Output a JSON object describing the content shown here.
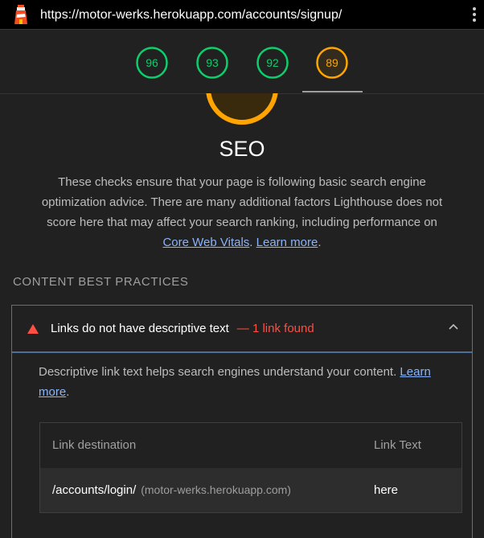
{
  "browser": {
    "url": "https://motor-werks.herokuapp.com/accounts/signup/"
  },
  "scores": [
    {
      "value": "96",
      "color": "#0cce6b"
    },
    {
      "value": "93",
      "color": "#0cce6b"
    },
    {
      "value": "92",
      "color": "#0cce6b"
    },
    {
      "value": "89",
      "color": "#ffa400"
    }
  ],
  "category": {
    "title": "SEO",
    "description_text": "These checks ensure that your page is following basic search engine optimization advice. There are many additional factors Lighthouse does not score here that may affect your search ranking, including performance on ",
    "core_web_vitals_link": "Core Web Vitals",
    "separator": ". ",
    "learn_more_link": "Learn more",
    "end_period": "."
  },
  "group": {
    "title": "CONTENT BEST PRACTICES"
  },
  "audit": {
    "title": "Links do not have descriptive text",
    "dash": "—",
    "count": "1 link found",
    "description": "Descriptive link text helps search engines understand your content. ",
    "learn_more": "Learn more",
    "end_period": ".",
    "table": {
      "headers": [
        "Link destination",
        "Link Text"
      ],
      "rows": [
        {
          "destination": "/accounts/login/",
          "host": "(motor-werks.herokuapp.com)",
          "text": "here"
        }
      ]
    }
  },
  "colors": {
    "pass": "#0cce6b",
    "average": "#ffa400",
    "fail": "#ff4e42",
    "link": "#8ab4f8"
  }
}
